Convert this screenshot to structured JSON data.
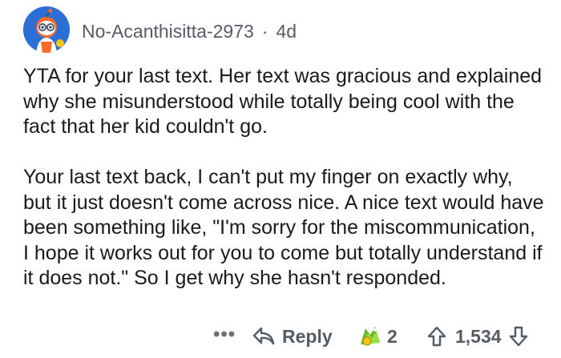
{
  "comment": {
    "username": "No-Acanthisitta-2973",
    "separator": "·",
    "age": "4d",
    "paragraphs": [
      "YTA for your last text. Her text was gracious and explained why she misunderstood while totally being cool with the fact that her kid couldn't go.",
      "Your last text back, I can't put my finger on exactly why, but it just doesn't come across nice. A nice text would have been something like, \"I'm sorry for the miscommunication, I hope it works out for you to come but totally understand if it does not.\" So I get why she hasn't responded."
    ]
  },
  "actions": {
    "more_label": "•••",
    "reply_label": "Reply",
    "award_count": "2",
    "score": "1,534"
  },
  "colors": {
    "text": "#1a1a1b",
    "meta": "#545c66",
    "avatar_bg": "#2b6fd6"
  },
  "icons": {
    "avatar": "snoo-avatar-icon",
    "reply": "reply-arrow-icon",
    "award": "award-icon",
    "upvote": "upvote-arrow-icon",
    "downvote": "downvote-arrow-icon"
  }
}
